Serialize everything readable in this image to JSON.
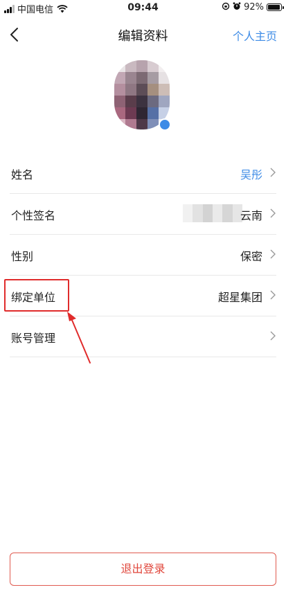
{
  "status_bar": {
    "carrier": "中国电信",
    "time": "09:44",
    "battery_text": "92%",
    "battery_level": 0.92,
    "icons": [
      "signal-icon",
      "wifi-icon",
      "lock-rotation-icon",
      "alarm-icon",
      "battery-icon"
    ]
  },
  "nav": {
    "title": "编辑资料",
    "right_link": "个人主页",
    "back_icon": "chevron-left-icon",
    "accent_color": "#3d8be6"
  },
  "profile_rows": [
    {
      "label": "姓名",
      "value": "吴彤",
      "value_color": "#3d8be6"
    },
    {
      "label": "个性签名",
      "value": "云南",
      "value_color": "#222222"
    },
    {
      "label": "性别",
      "value": "保密",
      "value_color": "#222222"
    },
    {
      "label": "绑定单位",
      "value": "超星集团",
      "value_color": "#222222"
    },
    {
      "label": "账号管理",
      "value": "",
      "value_color": "#222222"
    }
  ],
  "annotation": {
    "highlight_color": "#e02b2b"
  },
  "logout": {
    "label": "退出登录",
    "color": "#e0463b"
  }
}
